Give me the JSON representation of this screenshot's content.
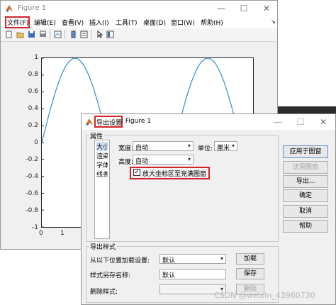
{
  "figure": {
    "title": "Figure 1",
    "menu": [
      "文件(F)",
      "编辑(E)",
      "查看(V)",
      "插入(I)",
      "工具(T)",
      "桌面(D)",
      "窗口(W)",
      "帮助(H)"
    ],
    "y_ticks": [
      "1",
      "0.8",
      "0.6",
      "0.4",
      "0.2",
      "0",
      "-0.2",
      "-0.4",
      "-0.6",
      "-0.8",
      "-1"
    ],
    "x_ticks": [
      "0",
      "1",
      "2"
    ],
    "window_controls": {
      "minimize": "—",
      "maximize": "☐",
      "close": "✕"
    },
    "menubar_right_arrow": "↘"
  },
  "chart_data": {
    "type": "line",
    "series": [
      {
        "values_desc": "",
        "x": [
          0,
          0.3927,
          0.7854,
          1.1781,
          1.5708,
          1.9635,
          2.3562,
          2.7489,
          3.1416,
          3.5343,
          3.927,
          4.3197,
          4.7124,
          5.1051,
          5.4978,
          5.8905,
          6.2832
        ],
        "y": [
          0,
          0.383,
          0.707,
          0.924,
          1,
          0.924,
          0.707,
          0.383,
          0,
          -0.383,
          -0.707,
          -0.924,
          -1,
          -0.924,
          -0.707,
          -0.383,
          0
        ]
      }
    ],
    "ylim": [
      -1,
      1
    ],
    "color": "#2e8ecf"
  },
  "dialog": {
    "title_highlight": "导出设置",
    "title_rest": ": Figure 1",
    "window_controls": {
      "minimize": "—",
      "maximize": "☐",
      "close": "✕"
    },
    "properties_group": "属性",
    "categories": [
      "大小",
      "渲染",
      "字体",
      "线条"
    ],
    "width_label": "宽度:",
    "width_value": "自动",
    "units_label": "单位:",
    "units_value": "厘米",
    "height_label": "高度:",
    "height_value": "自动",
    "expand_checkbox_label": "放大坐标区至充满图窗",
    "expand_checked": true,
    "buttons": {
      "apply": "应用于图窗",
      "restore": "还原图窗",
      "export": "导出...",
      "ok": "确定",
      "cancel": "取消",
      "help": "帮助"
    },
    "export_styles_group": "导出样式",
    "load_label": "从以下位置加载设置:",
    "load_value": "默认",
    "load_button": "加载",
    "save_label": "样式另存名称:",
    "save_value": "默认",
    "save_button": "保存",
    "delete_label": "删除样式:",
    "delete_button": "删除"
  },
  "watermark": "CSDN @weixin_43960730",
  "colors": {
    "highlight_box": "#d2232a",
    "line": "#2e8ecf",
    "matlab_icon": "#e06a1b"
  }
}
